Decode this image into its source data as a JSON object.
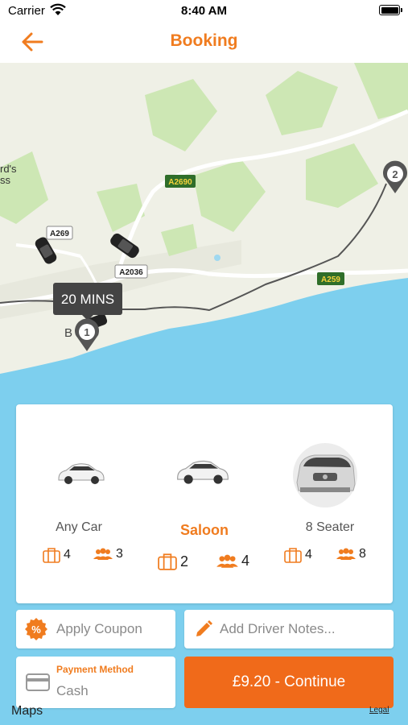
{
  "status_bar": {
    "carrier": "Carrier",
    "time": "8:40 AM"
  },
  "nav": {
    "title": "Booking",
    "accent": "#f07c1f"
  },
  "map": {
    "place_partial": "rd's\nss",
    "town_partial": "B   ill",
    "roads": [
      "A2690",
      "A269",
      "A2036",
      "A259"
    ],
    "eta_label": "20 MINS",
    "pickup_marker": "1",
    "dropoff_marker": "2",
    "maps_logo": "Maps",
    "legal": "Legal"
  },
  "vehicles": [
    {
      "name": "Any Car",
      "luggage": "4",
      "passengers": "3",
      "selected": false
    },
    {
      "name": "Saloon",
      "luggage": "2",
      "passengers": "4",
      "selected": true
    },
    {
      "name": "8 Seater",
      "luggage": "4",
      "passengers": "8",
      "selected": false
    }
  ],
  "actions": {
    "coupon_label": "Apply Coupon",
    "notes_label": "Add Driver Notes...",
    "payment_title": "Payment Method",
    "payment_value": "Cash",
    "continue_label": "£9.20 - Continue"
  },
  "colors": {
    "orange": "#f07c1f",
    "continue": "#f06a1a",
    "sea": "#7dcfee",
    "land": "#eff0e6"
  },
  "icons": [
    "wifi-icon",
    "battery-icon",
    "back-arrow-icon",
    "car-icon",
    "marker-icon",
    "luggage-icon",
    "passengers-icon",
    "percent-badge-icon",
    "pencil-icon",
    "credit-card-icon"
  ]
}
